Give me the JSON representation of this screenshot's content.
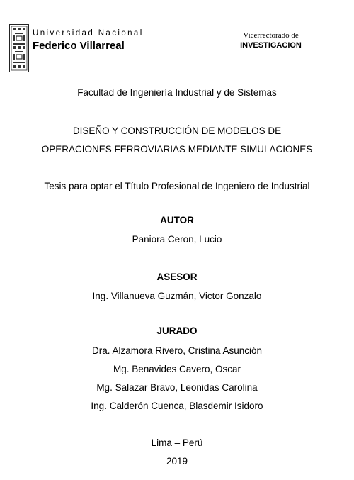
{
  "header": {
    "university_line1": "Universidad Nacional",
    "university_line2": "Federico Villarreal",
    "vice_line1": "Vicerrectorado de",
    "vice_line2": "INVESTIGACION"
  },
  "faculty": "Facultad de Ingeniería Industrial y de Sistemas",
  "title_lines": [
    "DISEÑO Y CONSTRUCCIÓN DE MODELOS DE",
    "OPERACIONES FERROVIARIAS MEDIANTE SIMULACIONES"
  ],
  "thesis_purpose": "Tesis para optar el Título Profesional de Ingeniero de Industrial",
  "author": {
    "heading": "AUTOR",
    "name": "Paniora Ceron, Lucio"
  },
  "advisor": {
    "heading": "ASESOR",
    "name": "Ing. Villanueva Guzmán, Victor Gonzalo"
  },
  "jury": {
    "heading": "JURADO",
    "members": [
      "Dra. Alzamora Rivero, Cristina Asunción",
      "Mg. Benavides Cavero, Oscar",
      "Mg. Salazar Bravo, Leonidas Carolina",
      "Ing. Calderón Cuenca, Blasdemir Isidoro"
    ]
  },
  "place": "Lima – Perú",
  "year": "2019"
}
